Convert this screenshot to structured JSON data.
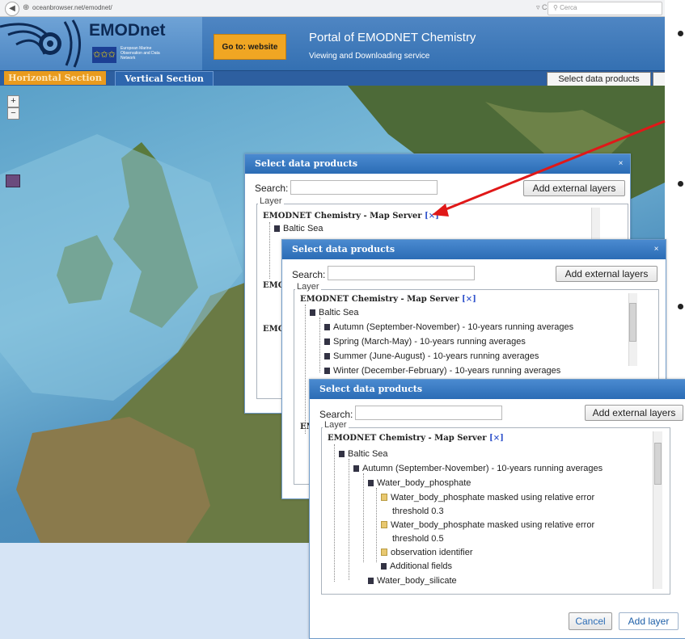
{
  "browser": {
    "url": "oceanbrowser.net/emodnet/",
    "search_placeholder": "Cerca",
    "reload_icon": "reload-icon"
  },
  "header": {
    "logo_title": "EMODnet",
    "logo_caption": "European Marine Observation and Data Network",
    "goto_button": "Go to: website",
    "portal_title": "Portal of EMODNET Chemistry",
    "portal_subtitle": "Viewing and Downloading service"
  },
  "tabs": {
    "horizontal": "Horizontal Section",
    "vertical": "Vertical Section",
    "select_products": "Select data products"
  },
  "map": {
    "zoom_in": "+",
    "zoom_out": "−"
  },
  "dialogs": {
    "title": "Select data products",
    "search_label": "Search:",
    "add_external": "Add external layers",
    "layer_legend": "Layer",
    "cancel": "Cancel",
    "add_layer": "Add layer"
  },
  "dialog1": {
    "root": "EMODNET Chemistry - Map Server",
    "close_marker": "[×]",
    "baltic": "Baltic Sea",
    "partial_1": "EMO",
    "partial_2": "EMO"
  },
  "dialog2": {
    "root": "EMODNET Chemistry - Map Server",
    "close_marker": "[×]",
    "baltic": "Baltic Sea",
    "items": [
      "Autumn (September-November) - 10-years running averages",
      "Spring (March-May) - 10-years running averages",
      "Summer (June-August) - 10-years running averages",
      "Winter (December-February) - 10-years running averages"
    ],
    "partial": "EM"
  },
  "dialog3": {
    "root": "EMODNET Chemistry - Map Server",
    "close_marker": "[×]",
    "baltic": "Baltic Sea",
    "autumn": "Autumn (September-November) - 10-years running averages",
    "phosphate": "Water_body_phosphate",
    "masked_03_a": "Water_body_phosphate masked using relative error",
    "masked_03_b": "threshold 0.3",
    "masked_05_a": "Water_body_phosphate masked using relative error",
    "masked_05_b": "threshold 0.5",
    "observation": "observation identifier",
    "additional": "Additional fields",
    "silicate": "Water_body_silicate"
  },
  "colors": {
    "header_blue": "#3a76b8",
    "tab_orange": "#e99b1e",
    "dialog_title_blue": "#2b6cb5",
    "annotation_arrow": "#e01818"
  }
}
